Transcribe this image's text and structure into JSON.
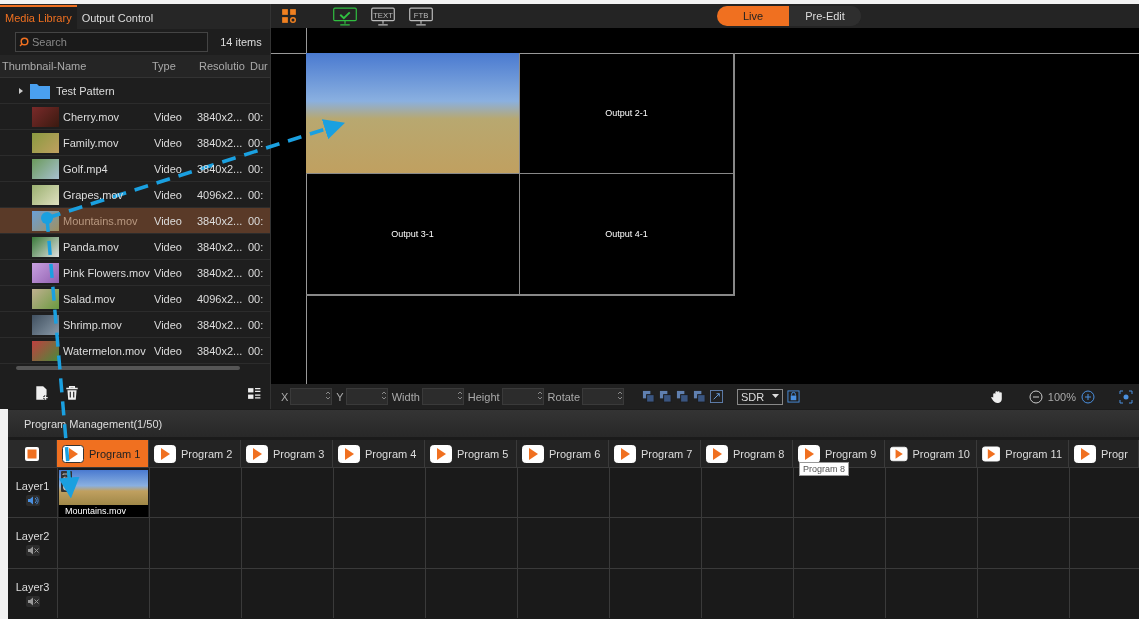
{
  "library": {
    "tabs": [
      {
        "label": "Media Library",
        "selected": true
      },
      {
        "label": "Output Control",
        "selected": false
      }
    ],
    "search": {
      "placeholder": "Search"
    },
    "count": "14 items",
    "columns": [
      "Thumbnail-Name",
      "Type",
      "Resolutio",
      "Dur"
    ],
    "folder": {
      "name": "Test Pattern",
      "expanded": false
    },
    "rows": [
      {
        "name": "Cherry.mov",
        "type": "Video",
        "resolution": "3840x2...",
        "duration": "00:",
        "selected": false
      },
      {
        "name": "Family.mov",
        "type": "Video",
        "resolution": "3840x2...",
        "duration": "00:",
        "selected": false
      },
      {
        "name": "Golf.mp4",
        "type": "Video",
        "resolution": "3840x2...",
        "duration": "00:",
        "selected": false
      },
      {
        "name": "Grapes.mov",
        "type": "Video",
        "resolution": "4096x2...",
        "duration": "00:",
        "selected": false
      },
      {
        "name": "Mountains.mov",
        "type": "Video",
        "resolution": "3840x2...",
        "duration": "00:",
        "selected": true
      },
      {
        "name": "Panda.mov",
        "type": "Video",
        "resolution": "3840x2...",
        "duration": "00:",
        "selected": false
      },
      {
        "name": "Pink Flowers.mov",
        "type": "Video",
        "resolution": "3840x2...",
        "duration": "00:",
        "selected": false
      },
      {
        "name": "Salad.mov",
        "type": "Video",
        "resolution": "4096x2...",
        "duration": "00:",
        "selected": false
      },
      {
        "name": "Shrimp.mov",
        "type": "Video",
        "resolution": "3840x2...",
        "duration": "00:",
        "selected": false
      },
      {
        "name": "Watermelon.mov",
        "type": "Video",
        "resolution": "3840x2...",
        "duration": "00:",
        "selected": false
      }
    ]
  },
  "toolbar": {
    "outputs": [
      {
        "kind": "check",
        "selected": true
      },
      {
        "kind": "text",
        "label": "TEXT",
        "selected": false
      },
      {
        "kind": "text",
        "label": "FTB",
        "selected": false
      }
    ],
    "modes": [
      {
        "label": "Live",
        "selected": true
      },
      {
        "label": "Pre-Edit",
        "selected": false
      }
    ]
  },
  "canvas": {
    "outputs": [
      {
        "kind": "photo"
      },
      {
        "kind": "label",
        "label": "Output 2-1"
      },
      {
        "kind": "label",
        "label": "Output 3-1"
      },
      {
        "kind": "label",
        "label": "Output 4-1"
      }
    ]
  },
  "properties": {
    "fields": [
      {
        "label": "X"
      },
      {
        "label": "Y"
      },
      {
        "label": "Width"
      },
      {
        "label": "Height"
      },
      {
        "label": "Rotate"
      }
    ],
    "dynamic_range": "SDR",
    "zoom": "100%"
  },
  "programs": {
    "title": "Program Management(1/50)",
    "tabs": [
      {
        "label": "Program 1",
        "selected": true
      },
      {
        "label": "Program 2",
        "selected": false
      },
      {
        "label": "Program 3",
        "selected": false
      },
      {
        "label": "Program 4",
        "selected": false
      },
      {
        "label": "Program 5",
        "selected": false
      },
      {
        "label": "Program 6",
        "selected": false
      },
      {
        "label": "Program 7",
        "selected": false
      },
      {
        "label": "Program 8",
        "selected": false
      },
      {
        "label": "Program 9",
        "selected": false
      },
      {
        "label": "Program 10",
        "selected": false
      },
      {
        "label": "Program 11",
        "selected": false
      },
      {
        "label": "Progr",
        "selected": false
      }
    ],
    "layers": [
      {
        "name": "Layer1",
        "muted": false,
        "clips": [
          {
            "name": "Mountains.mov"
          }
        ]
      },
      {
        "name": "Layer2",
        "muted": true
      },
      {
        "name": "Layer3",
        "muted": true
      }
    ],
    "tooltip": "Program 8"
  }
}
